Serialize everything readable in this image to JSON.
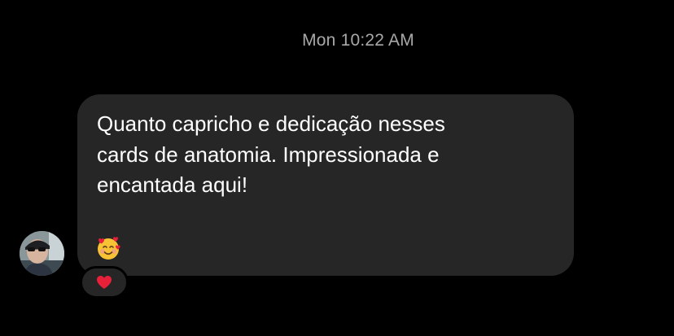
{
  "conversation": {
    "timestamp": "Mon 10:22 AM",
    "message": {
      "text": "Quanto capricho e dedicação nesses\ncards de anatomia. Impressionada e\nencantada aqui!",
      "emoji": "smiling-face-with-hearts",
      "reaction": "red-heart"
    },
    "sender": {
      "avatar": "profile-photo"
    }
  }
}
